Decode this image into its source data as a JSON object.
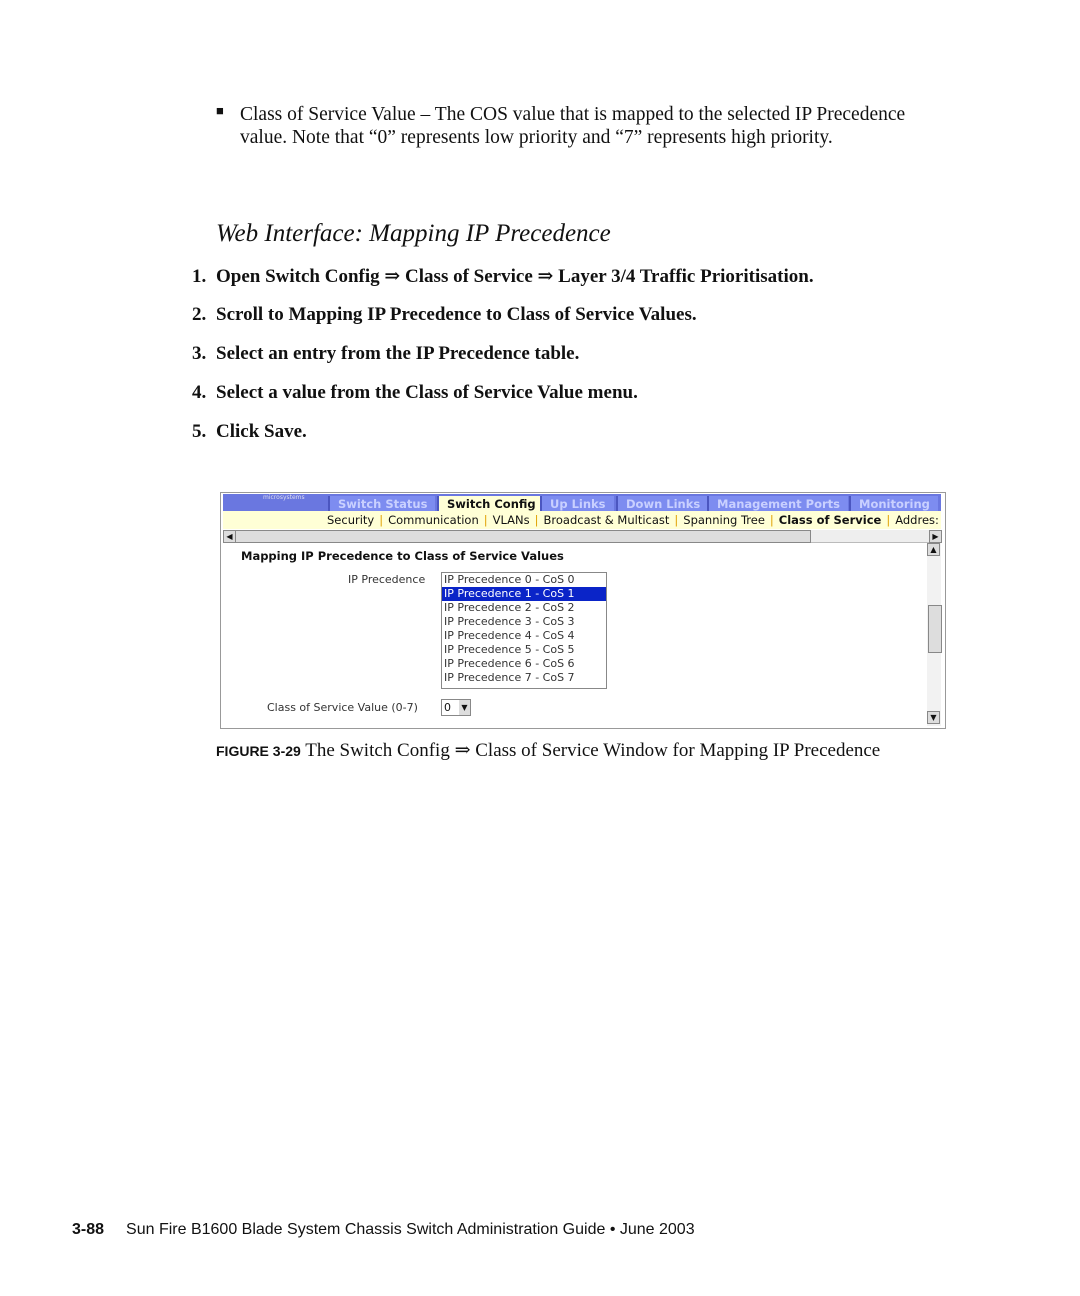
{
  "bullet": "Class of Service Value – The COS value that is mapped to the selected IP Precedence value. Note that “0” represents low priority and “7” represents high priority.",
  "heading": "Web Interface: Mapping IP Precedence",
  "steps": [
    {
      "n": "1.",
      "text": "Open Switch Config ⇒ Class of Service ⇒ Layer 3/4 Traffic Prioritisation."
    },
    {
      "n": "2.",
      "text": "Scroll to Mapping IP Precedence to Class of Service Values."
    },
    {
      "n": "3.",
      "text": "Select an entry from the IP Precedence table."
    },
    {
      "n": "4.",
      "text": "Select a value from the Class of Service Value menu."
    },
    {
      "n": "5.",
      "text": "Click Save."
    }
  ],
  "ui": {
    "logo": "microsystems",
    "tabs": [
      "Switch Status",
      "Switch Config",
      "Up Links",
      "Down Links",
      "Management Ports",
      "Monitoring"
    ],
    "active_tab": "Switch Config",
    "subnav": [
      "Security",
      "Communication",
      "VLANs",
      "Broadcast & Multicast",
      "Spanning Tree",
      "Class of Service",
      "Addres:"
    ],
    "active_subnav": "Class of Service",
    "section_title": "Mapping IP Precedence to Class of Service Values",
    "ip_label": "IP Precedence",
    "ip_options": [
      "IP Precedence 0 - CoS 0",
      "IP Precedence 1 - CoS 1",
      "IP Precedence 2 - CoS 2",
      "IP Precedence 3 - CoS 3",
      "IP Precedence 4 - CoS 4",
      "IP Precedence 5 - CoS 5",
      "IP Precedence 6 - CoS 6",
      "IP Precedence 7 - CoS 7"
    ],
    "selected_index": 1,
    "cos_label": "Class of Service Value (0-7)",
    "cos_value": "0",
    "colors": {
      "tabbar": "#6a77e0",
      "active": "#ffffd6",
      "selection": "#0a24c8"
    }
  },
  "caption": {
    "label": "FIGURE 3-29",
    "text": "The Switch Config ⇒ Class of Service Window for Mapping IP Precedence"
  },
  "footer": {
    "page": "3-88",
    "text": "Sun Fire B1600 Blade System Chassis Switch Administration Guide • June 2003"
  }
}
